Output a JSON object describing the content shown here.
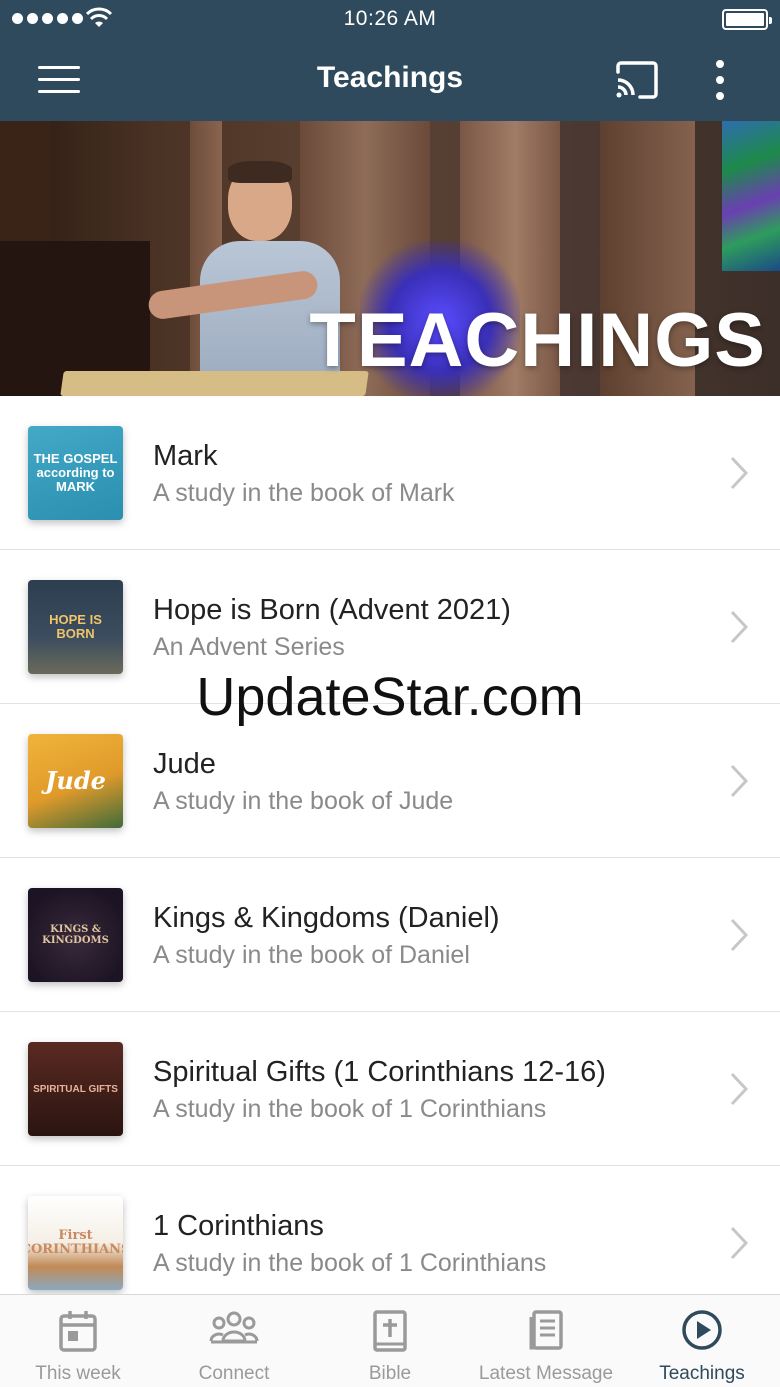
{
  "status_bar": {
    "time": "10:26 AM"
  },
  "nav": {
    "title": "Teachings"
  },
  "hero": {
    "title": "TEACHINGS"
  },
  "teachings": [
    {
      "title": "Mark",
      "subtitle": "A study in the book of Mark",
      "art": "THE GOSPEL according to MARK"
    },
    {
      "title": "Hope is Born (Advent 2021)",
      "subtitle": "An Advent Series",
      "art": "HOPE IS BORN"
    },
    {
      "title": "Jude",
      "subtitle": "A study in the book of Jude",
      "art": "Jude"
    },
    {
      "title": "Kings & Kingdoms (Daniel)",
      "subtitle": "A study in the book of Daniel",
      "art": "KINGS & KINGDOMS"
    },
    {
      "title": "Spiritual Gifts (1 Corinthians 12-16)",
      "subtitle": "A study in the book of 1 Corinthians",
      "art": "SPIRITUAL GIFTS"
    },
    {
      "title": "1 Corinthians",
      "subtitle": "A study in the book of 1 Corinthians",
      "art": "First CORINTHIANS"
    }
  ],
  "watermark": "UpdateStar.com",
  "tabs": [
    {
      "label": "This week",
      "icon": "calendar-icon",
      "active": false
    },
    {
      "label": "Connect",
      "icon": "people-icon",
      "active": false
    },
    {
      "label": "Bible",
      "icon": "bible-icon",
      "active": false
    },
    {
      "label": "Latest Message",
      "icon": "book-icon",
      "active": false
    },
    {
      "label": "Teachings",
      "icon": "play-circle-icon",
      "active": true
    }
  ],
  "colors": {
    "nav_bg": "#2f4a5c",
    "active_tab": "#2f4a5c",
    "inactive_tab": "#9a9a9a"
  }
}
